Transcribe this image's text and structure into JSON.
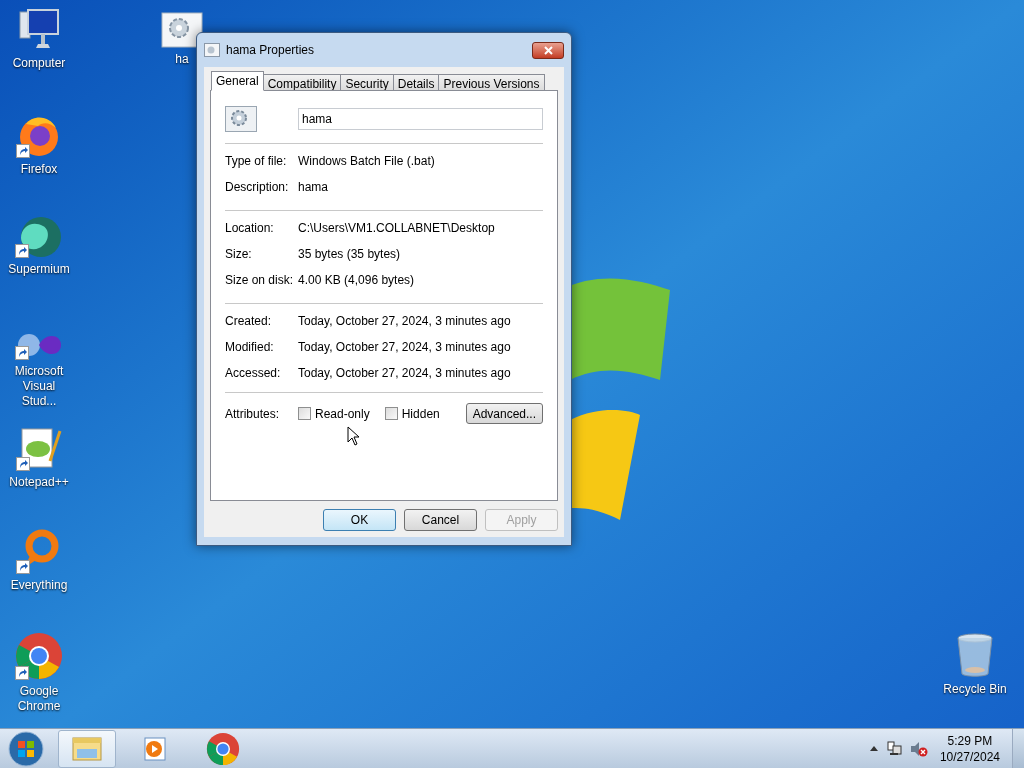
{
  "desktop_icons": [
    {
      "label": "Computer",
      "kind": "computer",
      "shortcut": false
    },
    {
      "label": "ha",
      "kind": "batch",
      "shortcut": false
    },
    {
      "label": "Firefox",
      "kind": "firefox",
      "shortcut": true
    },
    {
      "label": "Supermium",
      "kind": "supermium",
      "shortcut": true
    },
    {
      "label": "Microsoft Visual Stud...",
      "kind": "vs",
      "shortcut": true
    },
    {
      "label": "Notepad++",
      "kind": "notepad",
      "shortcut": true
    },
    {
      "label": "Everything",
      "kind": "everything",
      "shortcut": true
    },
    {
      "label": "Google Chrome",
      "kind": "chrome",
      "shortcut": true
    },
    {
      "label": "Recycle Bin",
      "kind": "recycle",
      "shortcut": false
    }
  ],
  "dialog": {
    "title": "hama Properties",
    "tabs": [
      {
        "label": "General",
        "selected": true
      },
      {
        "label": "Compatibility",
        "selected": false
      },
      {
        "label": "Security",
        "selected": false
      },
      {
        "label": "Details",
        "selected": false
      },
      {
        "label": "Previous Versions",
        "selected": false
      }
    ],
    "name_field": {
      "value": "hama"
    },
    "sections": [
      [
        {
          "label": "Type of file:",
          "value": "Windows Batch File (.bat)"
        },
        {
          "label": "Description:",
          "value": "hama"
        }
      ],
      [
        {
          "label": "Location:",
          "value": "C:\\Users\\VM1.COLLABNET\\Desktop"
        },
        {
          "label": "Size:",
          "value": "35 bytes (35 bytes)"
        },
        {
          "label": "Size on disk:",
          "value": "4.00 KB (4,096 bytes)"
        }
      ],
      [
        {
          "label": "Created:",
          "value": "Today, October 27, 2024, 3 minutes ago"
        },
        {
          "label": "Modified:",
          "value": "Today, October 27, 2024, 3 minutes ago"
        },
        {
          "label": "Accessed:",
          "value": "Today, October 27, 2024, 3 minutes ago"
        }
      ]
    ],
    "attributes": {
      "label": "Attributes:",
      "checkboxes": [
        {
          "label": "Read-only",
          "checked": false
        },
        {
          "label": "Hidden",
          "checked": false
        }
      ],
      "advanced_button": "Advanced..."
    },
    "buttons": [
      {
        "label": "OK",
        "default": true,
        "disabled": false
      },
      {
        "label": "Cancel",
        "default": false,
        "disabled": false
      },
      {
        "label": "Apply",
        "default": false,
        "disabled": true
      }
    ]
  },
  "taskbar": {
    "items": [
      {
        "kind": "explorer",
        "active": true
      },
      {
        "kind": "media",
        "active": false
      },
      {
        "kind": "chrome",
        "active": false
      }
    ],
    "clock": {
      "time": "5:29 PM",
      "date": "10/27/2024"
    },
    "tray": [
      {
        "kind": "arrow"
      },
      {
        "kind": "network"
      },
      {
        "kind": "volume_muted"
      }
    ]
  }
}
